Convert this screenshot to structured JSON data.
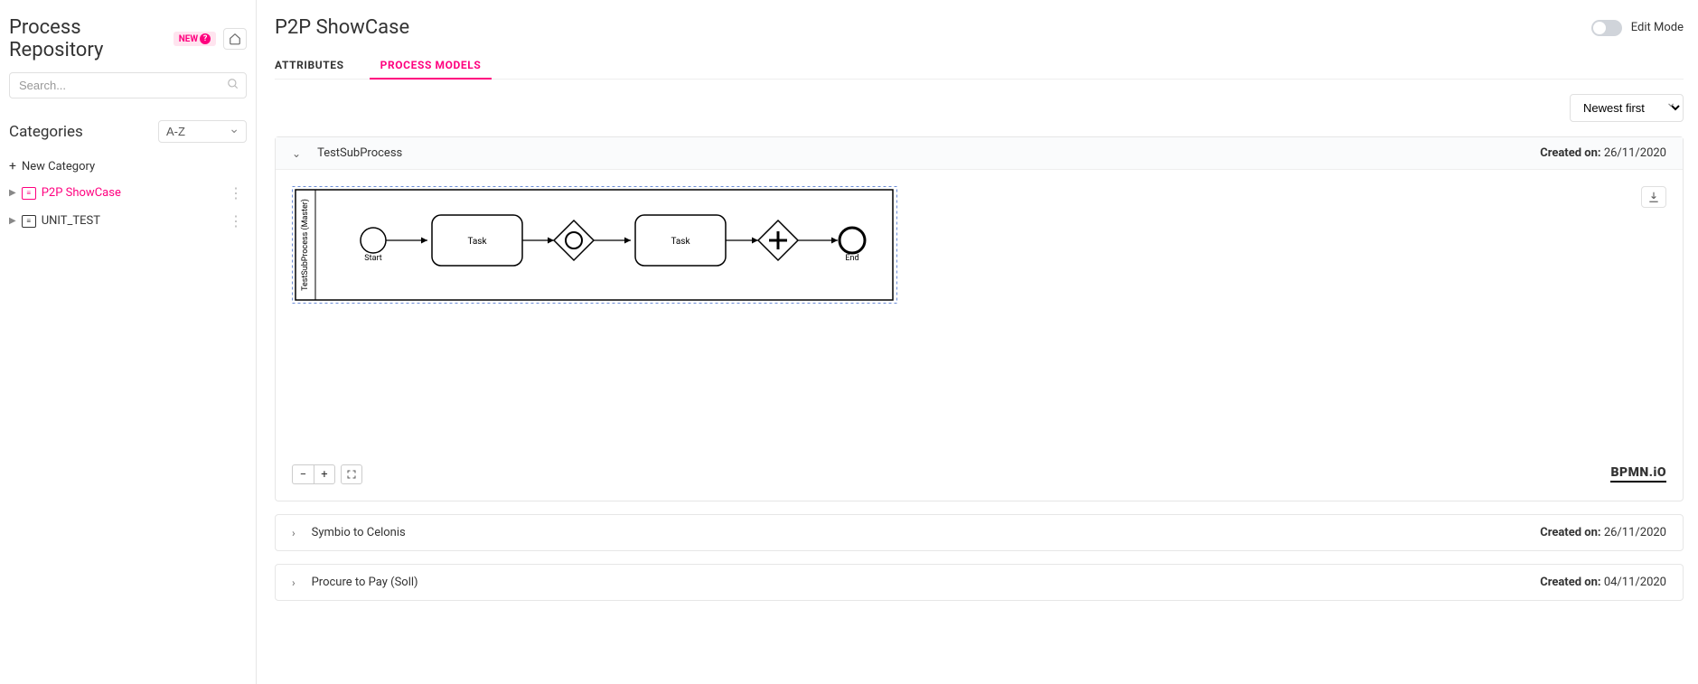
{
  "sidebar": {
    "title": "Process Repository",
    "newBadge": "NEW",
    "searchPlaceholder": "Search...",
    "categoriesTitle": "Categories",
    "sortValue": "A-Z",
    "newCategory": "New Category",
    "items": [
      {
        "label": "P2P ShowCase",
        "active": true
      },
      {
        "label": "UNIT_TEST",
        "active": false
      }
    ]
  },
  "header": {
    "title": "P2P ShowCase",
    "editMode": "Edit Mode"
  },
  "tabs": {
    "attributes": "ATTRIBUTES",
    "processModels": "PROCESS MODELS"
  },
  "sortSelect": "Newest first",
  "expandedPanel": {
    "title": "TestSubProcess",
    "createdLabel": "Created on:",
    "createdDate": "26/11/2020",
    "lane": "TestSubProcess (Master)",
    "start": "Start",
    "end": "End",
    "task1": "Task",
    "task2": "Task",
    "bpmn": "BPMN.iO"
  },
  "otherPanels": [
    {
      "title": "Symbio to Celonis",
      "createdLabel": "Created on:",
      "createdDate": "26/11/2020"
    },
    {
      "title": "Procure to Pay (Soll)",
      "createdLabel": "Created on:",
      "createdDate": "04/11/2020"
    }
  ]
}
